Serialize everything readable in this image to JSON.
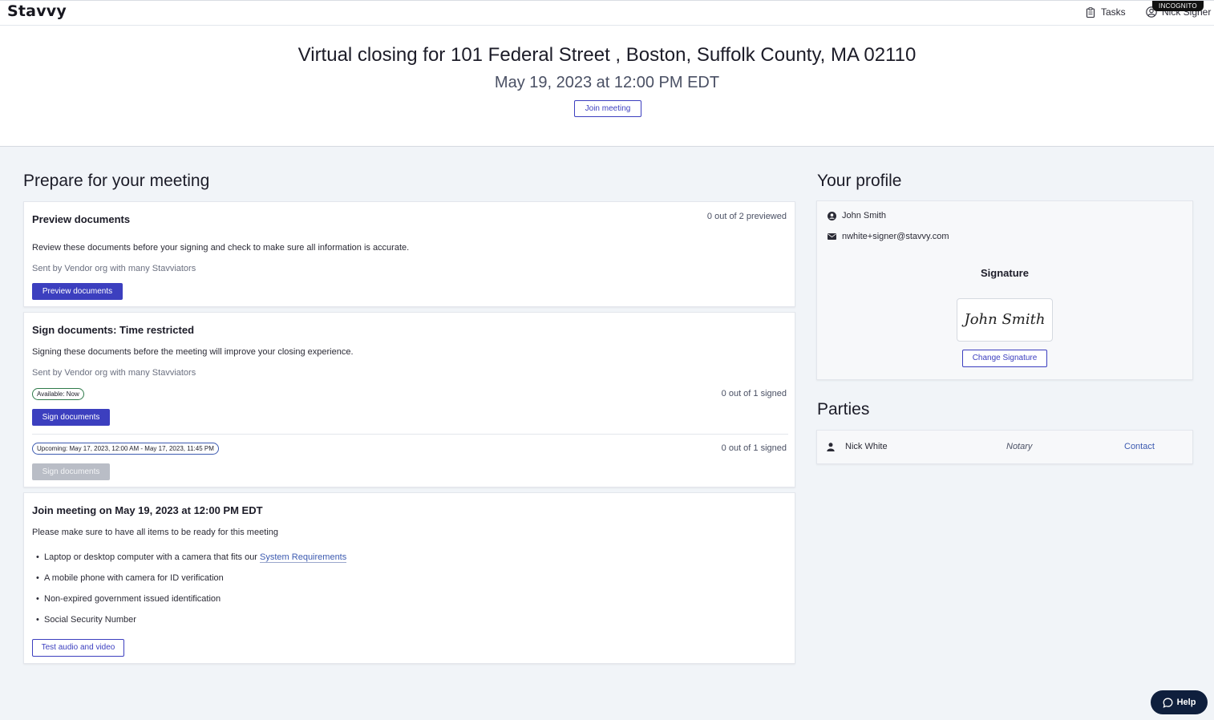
{
  "app": {
    "logo": "Stavvy",
    "incognito_label": "INCOGNITO"
  },
  "nav": {
    "tasks_label": "Tasks",
    "user_label": "Nick Signer"
  },
  "header": {
    "title": "Virtual closing for 101 Federal Street , Boston, Suffolk County, MA 02110",
    "date": "May 19, 2023 at 12:00 PM EDT",
    "join_button": "Join meeting"
  },
  "prepare": {
    "heading": "Prepare for your meeting",
    "preview": {
      "title": "Preview documents",
      "status": "0 out of 2 previewed",
      "description": "Review these documents before your signing and check to make sure all information is accurate.",
      "sender": "Sent by Vendor org with many Stavviators",
      "button": "Preview documents"
    },
    "sign": {
      "title": "Sign documents: Time restricted",
      "description": "Signing these documents before the meeting will improve your closing experience.",
      "sender": "Sent by Vendor org with many Stavviators",
      "groups": [
        {
          "badge": "Available: Now",
          "status": "0 out of 1 signed",
          "button": "Sign documents",
          "enabled": true
        },
        {
          "badge": "Upcoming: May 17, 2023, 12:00 AM - May 17, 2023, 11:45 PM",
          "status": "0 out of 1 signed",
          "button": "Sign documents",
          "enabled": false
        }
      ]
    },
    "meeting": {
      "title": "Join meeting on May 19, 2023 at 12:00 PM EDT",
      "description": "Please make sure to have all items to be ready for this meeting",
      "item_1_prefix": "Laptop or desktop computer with a camera that fits our ",
      "item_1_link": "System Requirements",
      "item_2": "A mobile phone with camera for ID verification",
      "item_3": "Non-expired government issued identification",
      "item_4": "Social Security Number",
      "button": "Test audio and video"
    }
  },
  "profile": {
    "heading": "Your profile",
    "name": "John Smith",
    "email": "nwhite+signer@stavvy.com",
    "signature_heading": "Signature",
    "signature_text": "John Smith",
    "change_button": "Change Signature"
  },
  "parties": {
    "heading": "Parties",
    "rows": [
      {
        "name": "Nick White",
        "role": "Notary",
        "action": "Contact"
      }
    ]
  },
  "help": {
    "label": "Help"
  },
  "colors": {
    "primary": "#3c3fbf",
    "available_badge": "#2f7a4a",
    "help_bg": "#0f1f3d",
    "page_bg": "#f1f4f8"
  },
  "icons": {
    "tasks": "clipboard-icon",
    "user": "user-circle-icon",
    "profile_name": "user-circle-solid-icon",
    "profile_email": "envelope-icon",
    "party": "person-icon",
    "help": "chat-bubble-icon"
  }
}
